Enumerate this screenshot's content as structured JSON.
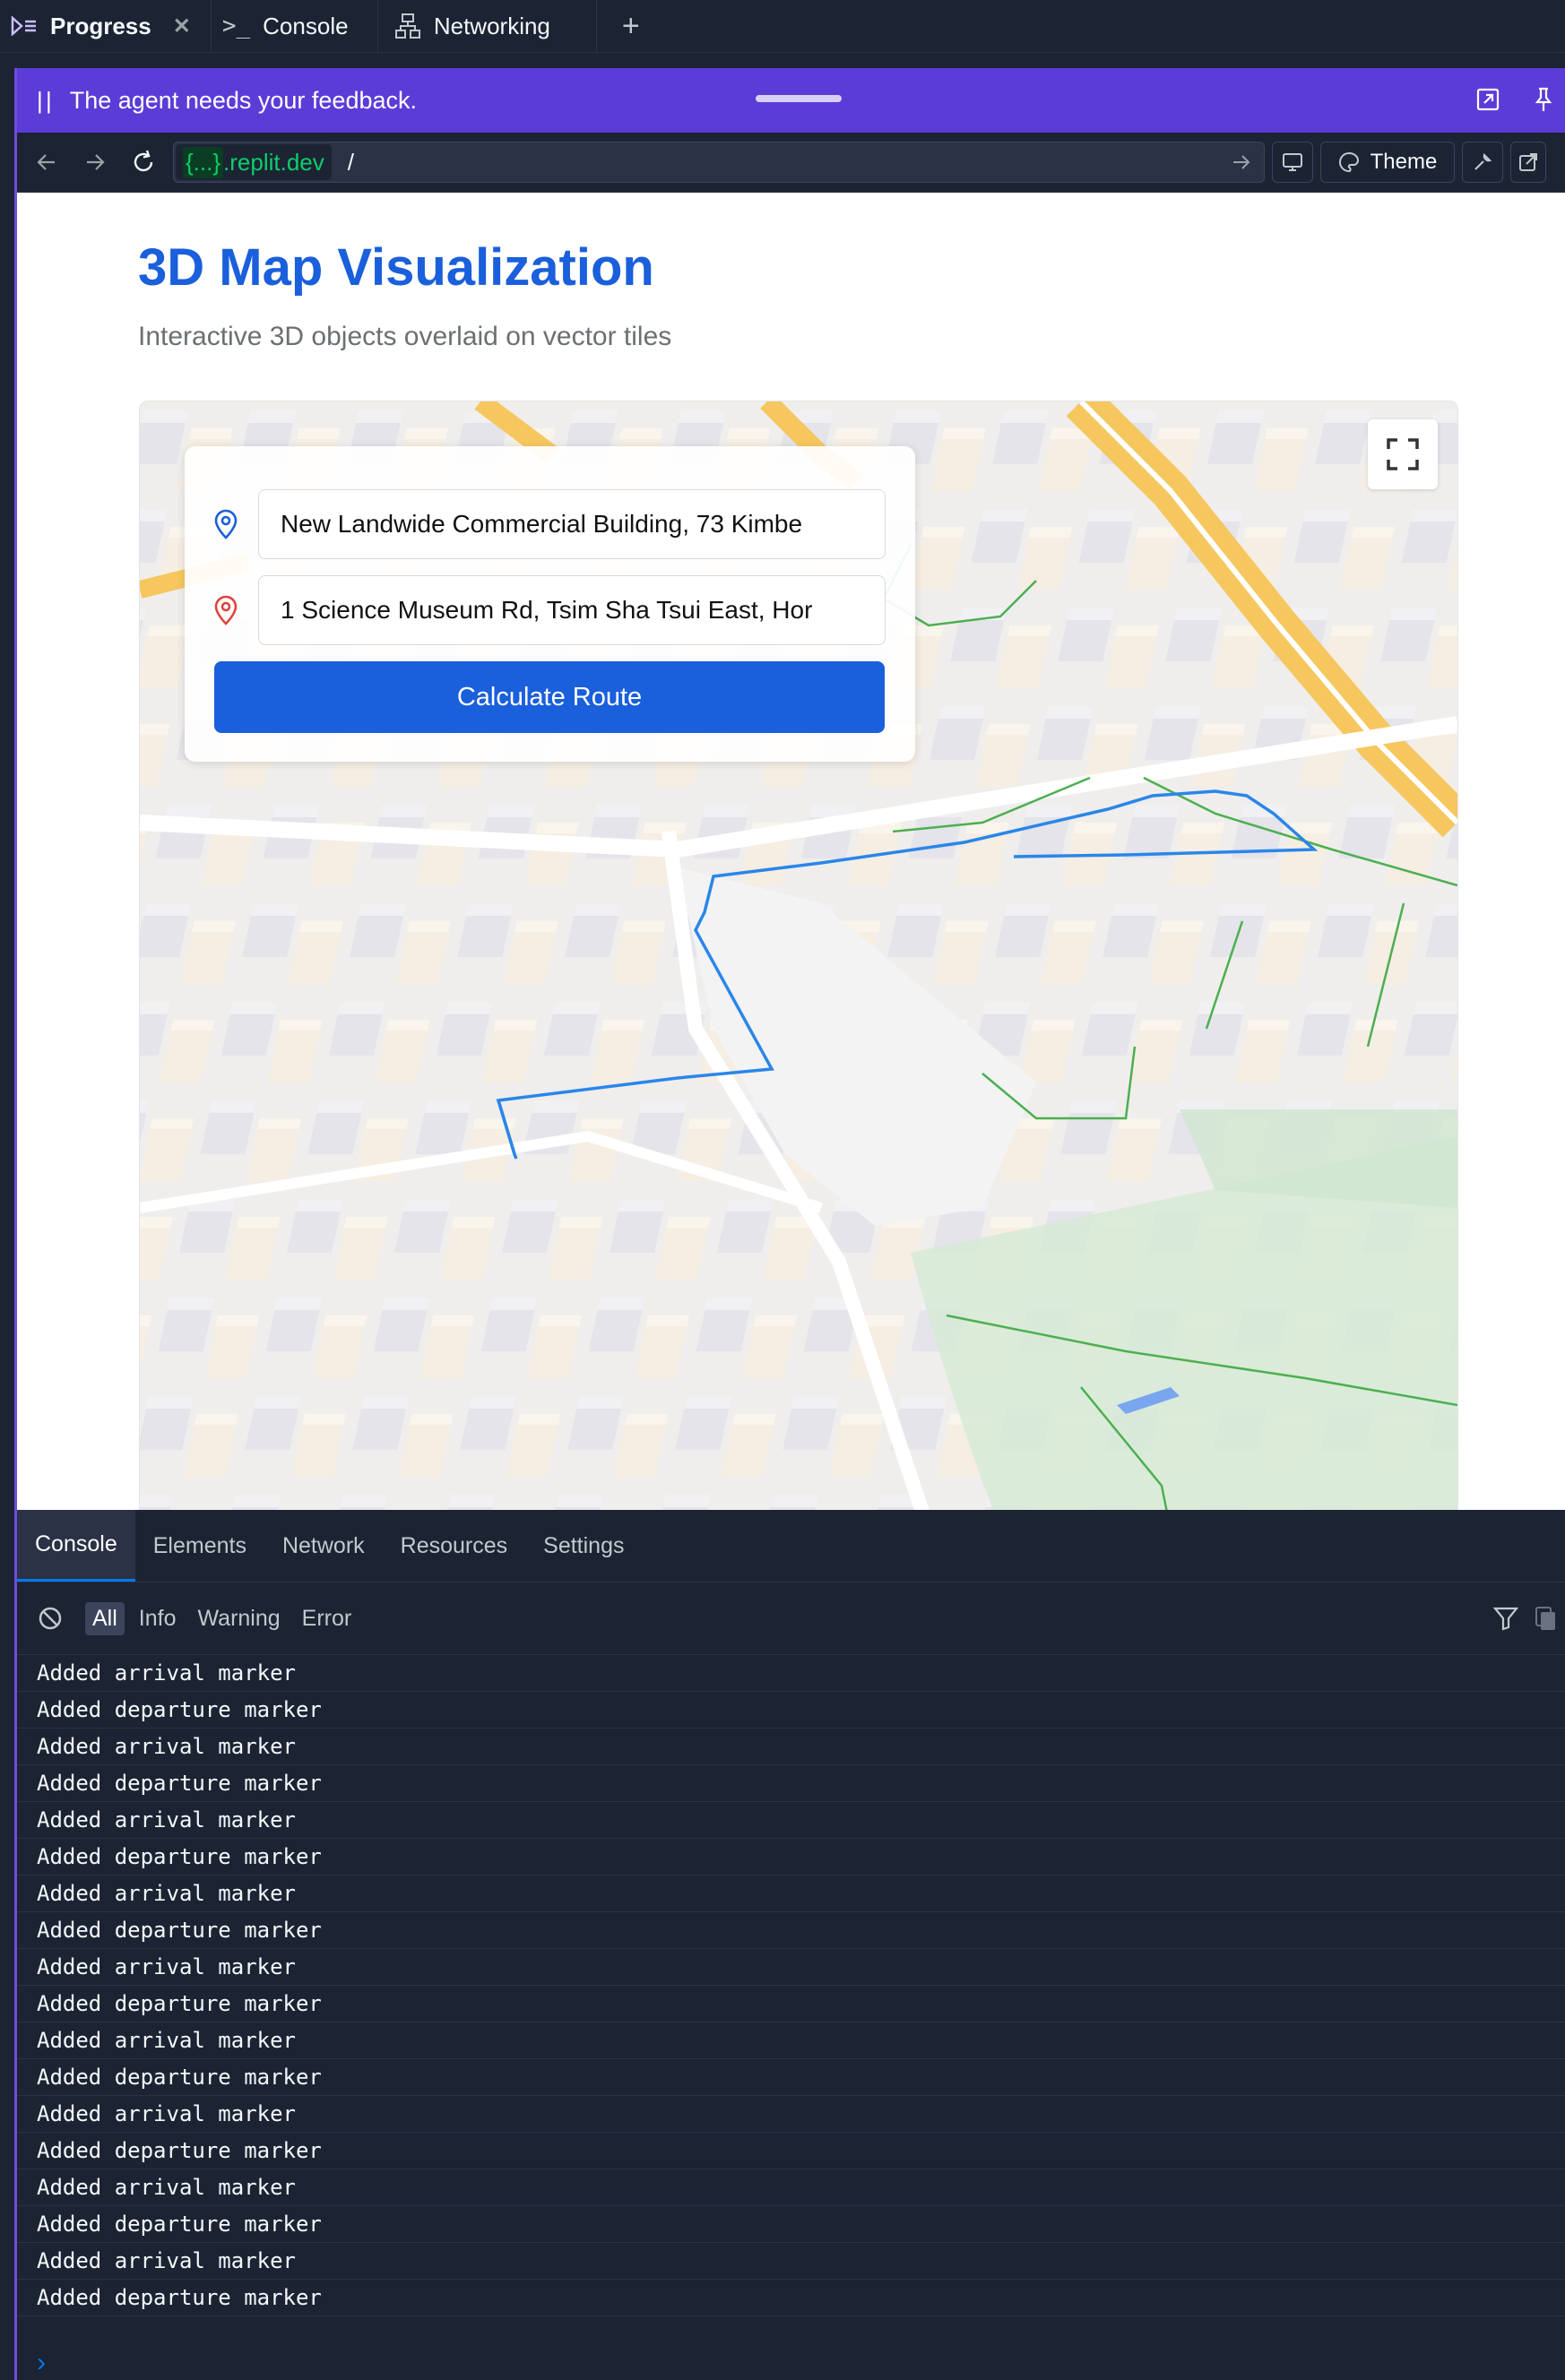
{
  "tabs": [
    {
      "label": "Progress",
      "icon": "progress-icon",
      "active": true
    },
    {
      "label": "Console",
      "icon": "terminal-icon"
    },
    {
      "label": "Networking",
      "icon": "network-icon"
    }
  ],
  "banner": {
    "message": "The agent needs your feedback."
  },
  "url": {
    "host_prefix": "{...}",
    "host": ".replit.dev",
    "path": "/"
  },
  "toolbar": {
    "theme_label": "Theme"
  },
  "page": {
    "title": "3D Map Visualization",
    "subtitle": "Interactive 3D objects overlaid on vector tiles",
    "origin": "New Landwide Commercial Building, 73 Kimbe",
    "destination": "1 Science Museum Rd, Tsim Sha Tsui East, Hor",
    "calculate_label": "Calculate Route"
  },
  "devtools": {
    "tabs": [
      "Console",
      "Elements",
      "Network",
      "Resources",
      "Settings"
    ],
    "filters": [
      "All",
      "Info",
      "Warning",
      "Error"
    ],
    "logs": [
      "Added arrival marker",
      "Added departure marker",
      "Added arrival marker",
      "Added departure marker",
      "Added arrival marker",
      "Added departure marker",
      "Added arrival marker",
      "Added departure marker",
      "Added arrival marker",
      "Added departure marker",
      "Added arrival marker",
      "Added departure marker",
      "Added arrival marker",
      "Added departure marker",
      "Added arrival marker",
      "Added departure marker",
      "Added arrival marker",
      "Added departure marker"
    ]
  },
  "colors": {
    "accent": "#1a5fdb",
    "banner": "#5b3cd7",
    "route": "#2a86e8",
    "host": "#0cce6b"
  }
}
